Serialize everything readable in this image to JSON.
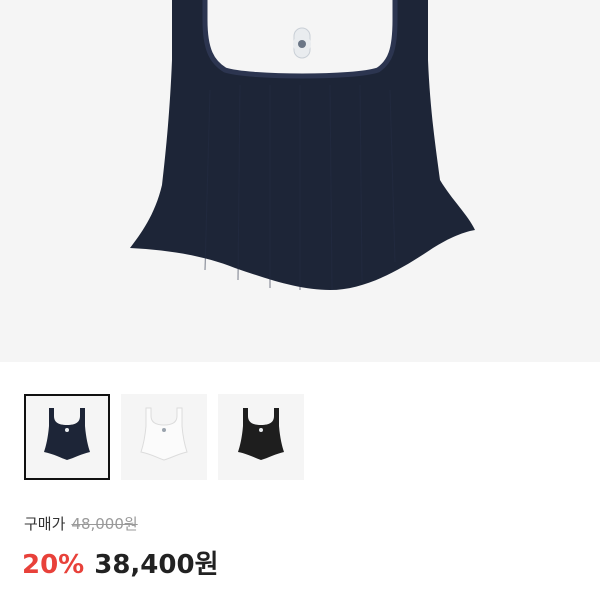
{
  "product": {
    "main_image": {
      "icon": "navy-tank-top-image",
      "color": "#1d2537"
    },
    "thumbnails": [
      {
        "icon": "navy-tank-top-thumbnail",
        "color": "#1d2537",
        "selected": true
      },
      {
        "icon": "white-tank-top-thumbnail",
        "color": "#f2f2f2",
        "selected": false
      },
      {
        "icon": "black-tank-top-thumbnail",
        "color": "#1e1e1e",
        "selected": false
      }
    ]
  },
  "pricing": {
    "label": "구매가",
    "original_price": "48,000원",
    "discount": "20%",
    "final_price": "38,400원",
    "discount_color": "#e8413a"
  }
}
